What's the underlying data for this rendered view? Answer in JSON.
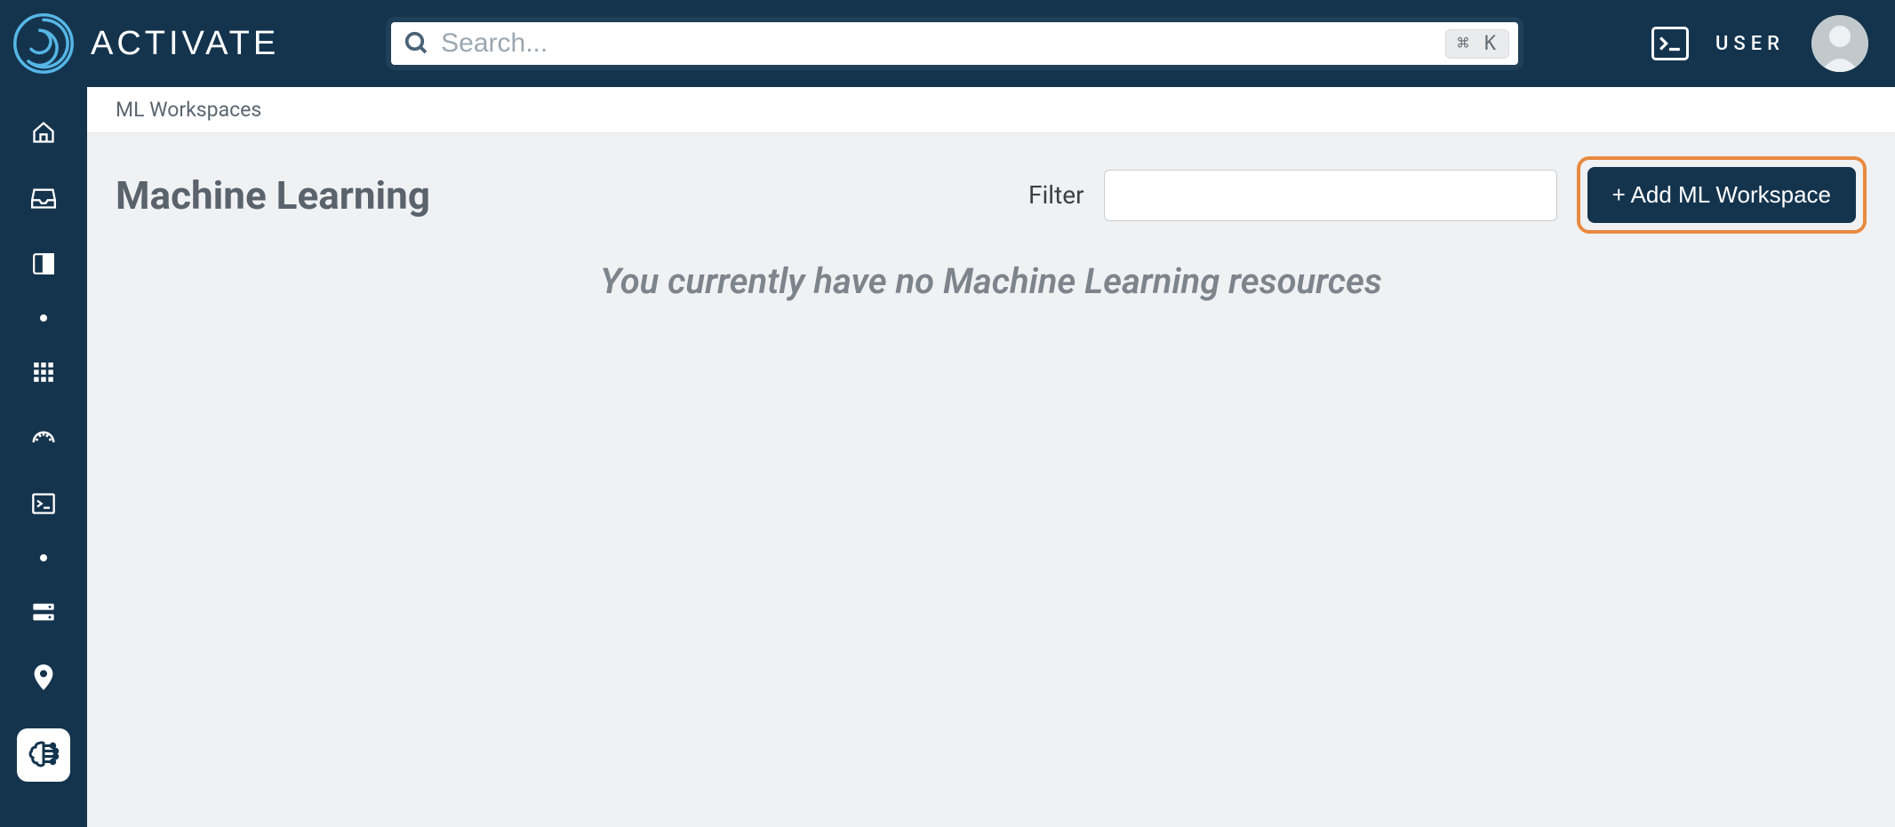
{
  "header": {
    "brand": "ACTIVATE",
    "search_placeholder": "Search...",
    "kbd_hint": "⌘ K",
    "user_label": "USER"
  },
  "sidebar": {
    "items": [
      {
        "name": "home-icon"
      },
      {
        "name": "inbox-icon"
      },
      {
        "name": "panel-icon"
      },
      {
        "name": "dot-separator"
      },
      {
        "name": "grid-icon"
      },
      {
        "name": "dashboard-icon"
      },
      {
        "name": "terminal-icon"
      },
      {
        "name": "dot-separator"
      },
      {
        "name": "server-icon"
      },
      {
        "name": "location-icon"
      },
      {
        "name": "brain-icon",
        "active": true
      }
    ]
  },
  "main": {
    "breadcrumb": "ML Workspaces",
    "page_title": "Machine Learning",
    "filter_label": "Filter",
    "filter_value": "",
    "add_button_label": "+ Add ML Workspace",
    "empty_message": "You currently have no Machine Learning resources"
  }
}
